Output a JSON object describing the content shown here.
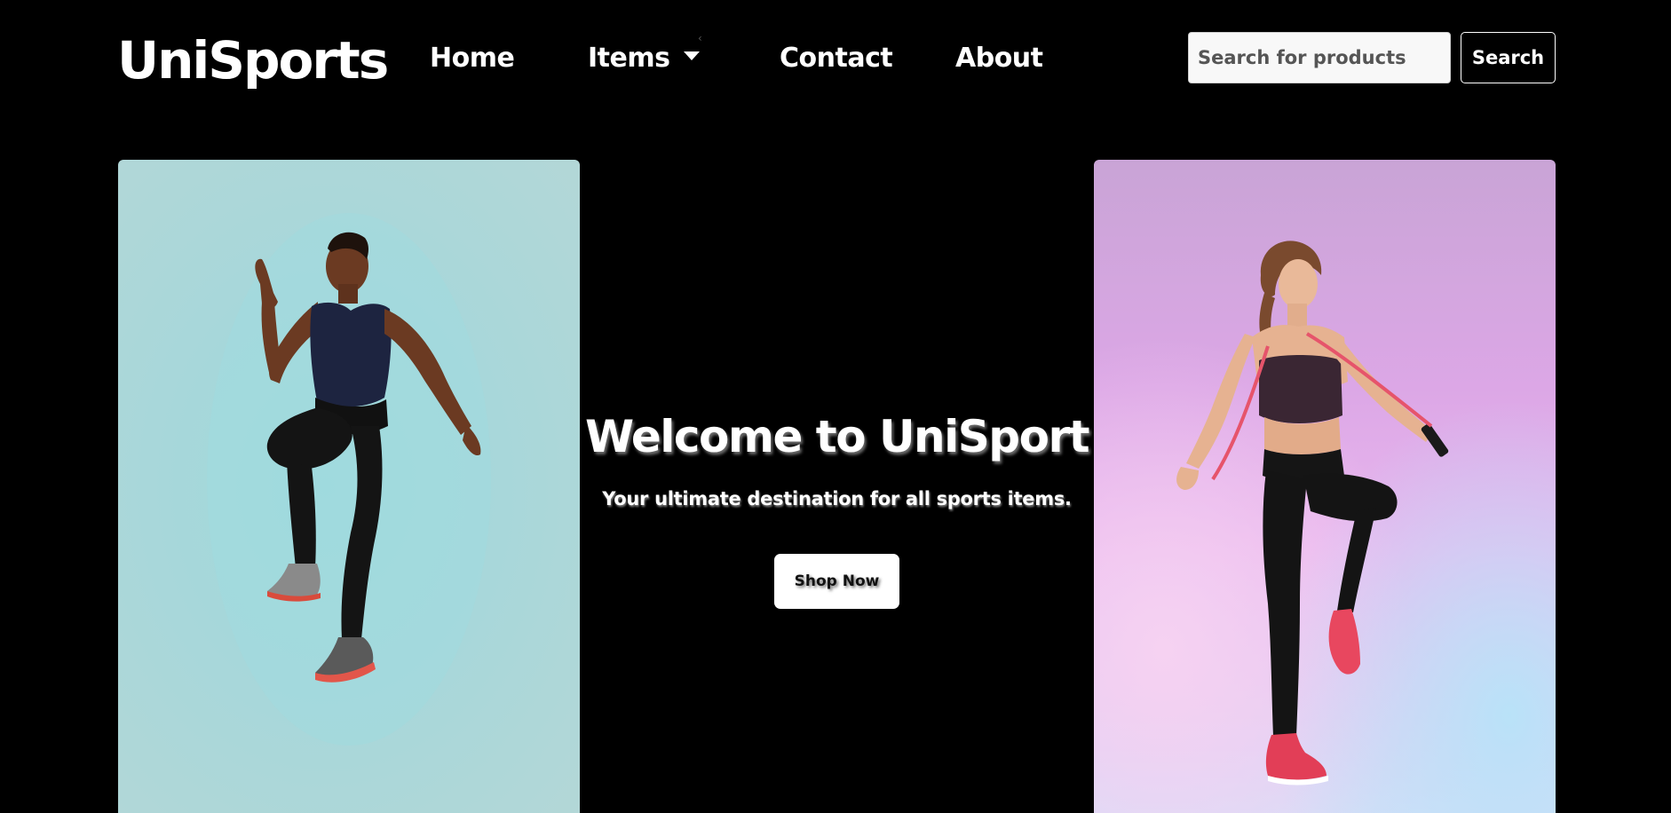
{
  "navbar": {
    "brand": "UniSports",
    "links": {
      "home": "Home",
      "items": "Items",
      "contact": "Contact",
      "about": "About"
    },
    "items_dropdown_icon": "caret-down-icon",
    "search": {
      "placeholder": "Search for products",
      "value": "",
      "button_label": "Search"
    }
  },
  "hero": {
    "title": "Welcome to UniSport",
    "subtitle": "Your ultimate destination for all sports items.",
    "cta_label": "Shop Now",
    "left_image": "man-jumping-athlete-photo",
    "right_image": "woman-jump-rope-athlete-photo"
  },
  "colors": {
    "background": "#000000",
    "text": "#ffffff",
    "left_image_bg": "#a7d7da",
    "right_image_bg": "#dca7e6",
    "button_bg": "#ffffff"
  }
}
